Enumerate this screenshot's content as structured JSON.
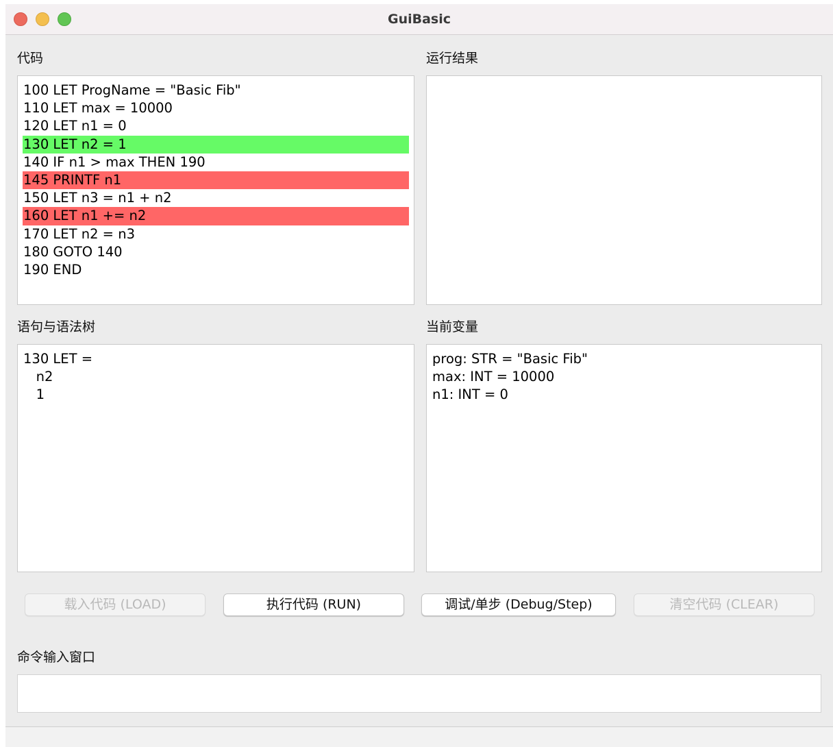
{
  "window": {
    "title": "GuiBasic"
  },
  "colors": {
    "highlight_current": "#66fa66",
    "highlight_breakpoint": "#ff6666"
  },
  "code_panel": {
    "label": "代码",
    "lines": [
      {
        "text": "100 LET ProgName = \"Basic Fib\"",
        "highlight": "none"
      },
      {
        "text": "110 LET max = 10000",
        "highlight": "none"
      },
      {
        "text": "120 LET n1 = 0",
        "highlight": "none"
      },
      {
        "text": "130 LET n2 = 1",
        "highlight": "green"
      },
      {
        "text": "140 IF n1 > max THEN 190",
        "highlight": "none"
      },
      {
        "text": "145 PRINTF n1",
        "highlight": "red"
      },
      {
        "text": "150 LET n3 = n1 + n2",
        "highlight": "none"
      },
      {
        "text": "160 LET n1 += n2",
        "highlight": "red"
      },
      {
        "text": "170 LET n2 = n3",
        "highlight": "none"
      },
      {
        "text": "180 GOTO 140",
        "highlight": "none"
      },
      {
        "text": "190 END",
        "highlight": "none"
      }
    ]
  },
  "result_panel": {
    "label": "运行结果",
    "lines": []
  },
  "syntax_panel": {
    "label": "语句与语法树",
    "lines": [
      "130 LET =",
      "   n2",
      "   1"
    ]
  },
  "vars_panel": {
    "label": "当前变量",
    "lines": [
      "prog: STR = \"Basic Fib\"",
      "max: INT = 10000",
      "n1: INT = 0"
    ]
  },
  "buttons": {
    "load": {
      "label": "载入代码 (LOAD)",
      "enabled": false
    },
    "run": {
      "label": "执行代码 (RUN)",
      "enabled": true
    },
    "debug": {
      "label": "调试/单步 (Debug/Step)",
      "enabled": true
    },
    "clear": {
      "label": "清空代码 (CLEAR)",
      "enabled": false
    }
  },
  "command": {
    "label": "命令输入窗口",
    "value": ""
  }
}
